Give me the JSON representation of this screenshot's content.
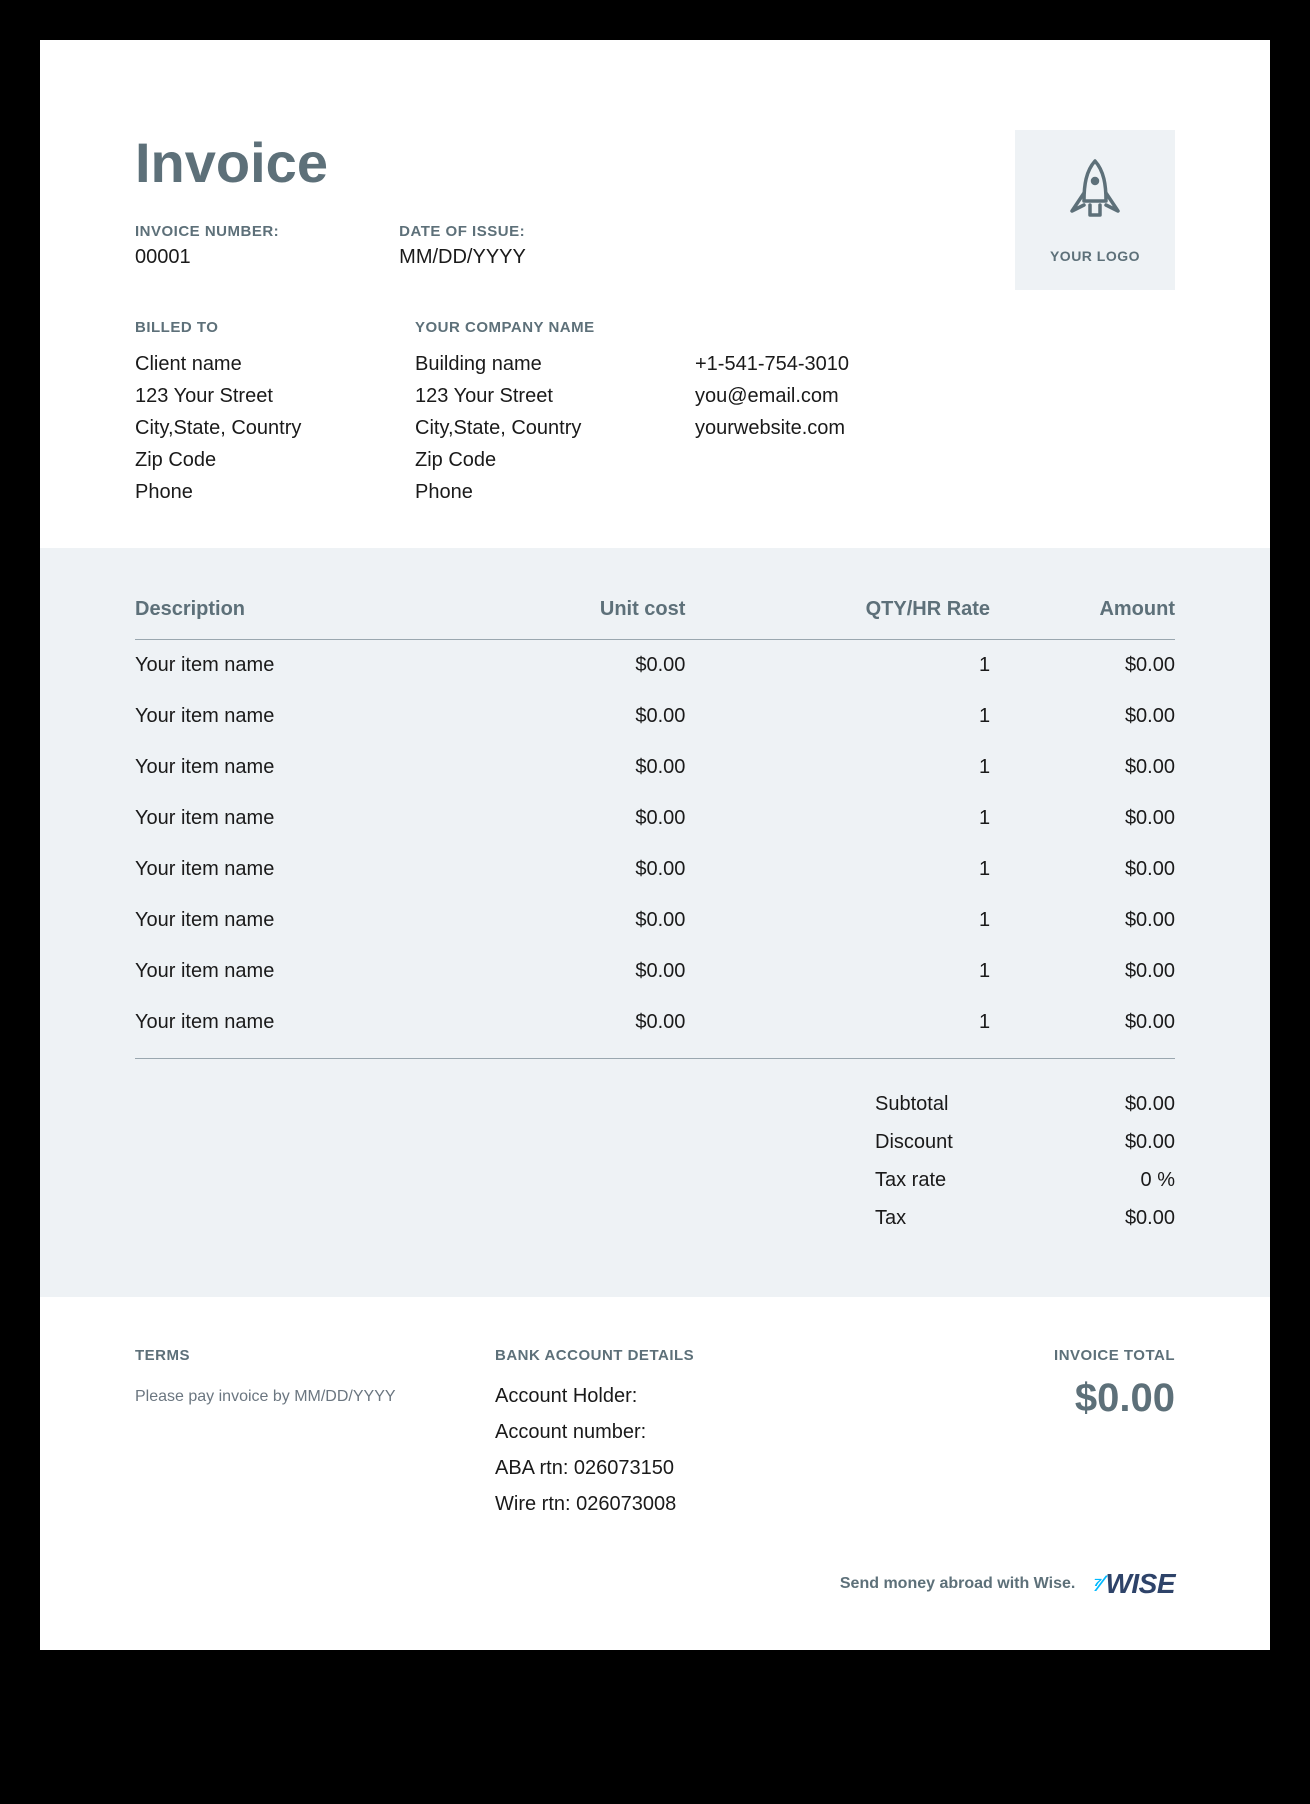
{
  "title": "Invoice",
  "invoice_number_label": "INVOICE NUMBER:",
  "invoice_number": "00001",
  "date_label": "DATE OF ISSUE:",
  "date_value": "MM/DD/YYYY",
  "logo_caption": "YOUR LOGO",
  "billed_to_label": "BILLED TO",
  "billed_to": {
    "l1": "Client name",
    "l2": "123 Your Street",
    "l3": "City,State, Country",
    "l4": "Zip Code",
    "l5": "Phone"
  },
  "company_label": "YOUR COMPANY NAME",
  "company": {
    "l1": "Building name",
    "l2": "123 Your Street",
    "l3": "City,State, Country",
    "l4": "Zip Code",
    "l5": "Phone"
  },
  "contact": {
    "phone": "+1-541-754-3010",
    "email": "you@email.com",
    "web": "yourwebsite.com"
  },
  "columns": {
    "desc": "Description",
    "unit": "Unit cost",
    "qty": "QTY/HR Rate",
    "amount": "Amount"
  },
  "items": [
    {
      "desc": "Your item name",
      "unit": "$0.00",
      "qty": "1",
      "amount": "$0.00"
    },
    {
      "desc": "Your item name",
      "unit": "$0.00",
      "qty": "1",
      "amount": "$0.00"
    },
    {
      "desc": "Your item name",
      "unit": "$0.00",
      "qty": "1",
      "amount": "$0.00"
    },
    {
      "desc": "Your item name",
      "unit": "$0.00",
      "qty": "1",
      "amount": "$0.00"
    },
    {
      "desc": "Your item name",
      "unit": "$0.00",
      "qty": "1",
      "amount": "$0.00"
    },
    {
      "desc": "Your item name",
      "unit": "$0.00",
      "qty": "1",
      "amount": "$0.00"
    },
    {
      "desc": "Your item name",
      "unit": "$0.00",
      "qty": "1",
      "amount": "$0.00"
    },
    {
      "desc": "Your item name",
      "unit": "$0.00",
      "qty": "1",
      "amount": "$0.00"
    }
  ],
  "totals": {
    "subtotal_label": "Subtotal",
    "subtotal": "$0.00",
    "discount_label": "Discount",
    "discount": "$0.00",
    "taxrate_label": "Tax rate",
    "taxrate": "0 %",
    "tax_label": "Tax",
    "tax": "$0.00"
  },
  "terms_label": "TERMS",
  "terms_text": "Please pay invoice by MM/DD/YYYY",
  "bank_label": "BANK ACCOUNT DETAILS",
  "bank": {
    "holder": "Account Holder:",
    "number": "Account number:",
    "aba": "ABA rtn: 026073150",
    "wire": "Wire rtn: 026073008"
  },
  "invoice_total_label": "INVOICE TOTAL",
  "invoice_total": "$0.00",
  "wise_text": "Send money abroad with Wise.",
  "wise_brand": "WISE"
}
